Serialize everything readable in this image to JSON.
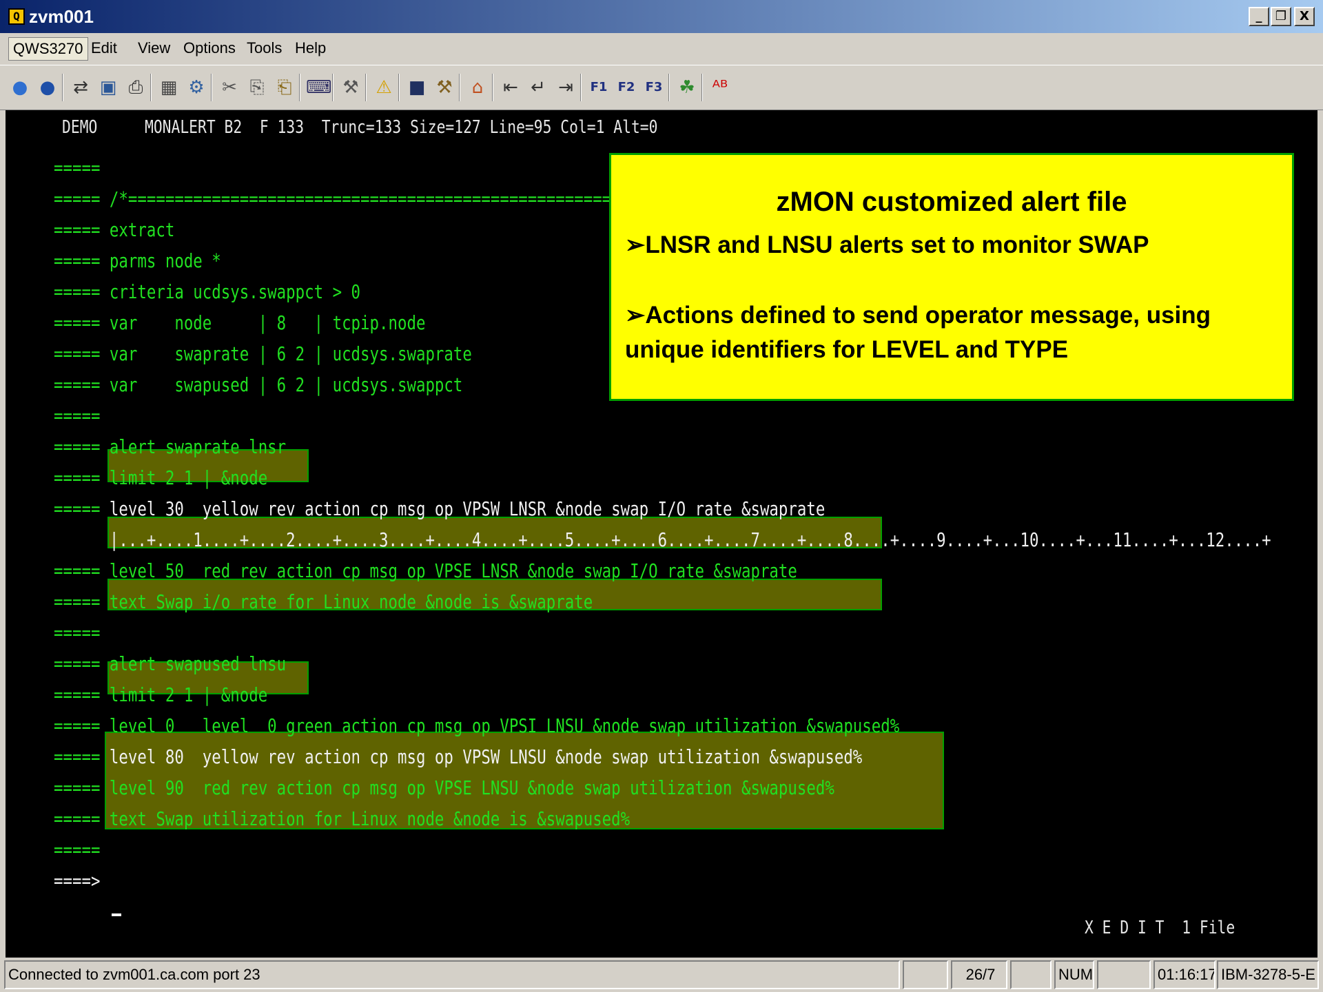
{
  "window": {
    "title": "zvm001",
    "minimize": "_",
    "maximize": "❐",
    "close": "X"
  },
  "menu": [
    "QWS3270",
    "Edit",
    "View",
    "Options",
    "Tools",
    "Help"
  ],
  "toolbar": [
    {
      "name": "connect-globe-icon",
      "glyph": "●",
      "color": "#2f6fd0"
    },
    {
      "name": "disconnect-globe-icon",
      "glyph": "●",
      "color": "#1e4fa8"
    },
    {
      "name": "transfer-icon",
      "glyph": "⇄",
      "color": "#333333"
    },
    {
      "name": "screen-icon",
      "glyph": "▣",
      "color": "#2b5797"
    },
    {
      "name": "print-icon",
      "glyph": "⎙",
      "color": "#333333"
    },
    {
      "name": "capture-icon",
      "glyph": "▦",
      "color": "#444444"
    },
    {
      "name": "macro-icon",
      "glyph": "⚙",
      "color": "#3060a0"
    },
    {
      "name": "cut-icon",
      "glyph": "✂",
      "color": "#555555"
    },
    {
      "name": "copy-icon",
      "glyph": "⎘",
      "color": "#555555"
    },
    {
      "name": "paste-icon",
      "glyph": "⎗",
      "color": "#8a6a1a"
    },
    {
      "name": "keyboard-icon",
      "glyph": "⌨",
      "color": "#333366"
    },
    {
      "name": "tools-icon",
      "glyph": "⚒",
      "color": "#555555"
    },
    {
      "name": "warning-icon",
      "glyph": "⚠",
      "color": "#d4a000"
    },
    {
      "name": "terminal-icon",
      "glyph": "■",
      "color": "#203060"
    },
    {
      "name": "settings-icon",
      "glyph": "⚒",
      "color": "#806020"
    },
    {
      "name": "home-icon",
      "glyph": "⌂",
      "color": "#c05020"
    },
    {
      "name": "field-back-icon",
      "glyph": "⇤",
      "color": "#333333"
    },
    {
      "name": "newline-icon",
      "glyph": "↵",
      "color": "#333333"
    },
    {
      "name": "field-forward-icon",
      "glyph": "⇥",
      "color": "#333333"
    },
    {
      "name": "pf1-icon",
      "glyph": "F1",
      "color": "#203080"
    },
    {
      "name": "pf2-icon",
      "glyph": "F2",
      "color": "#203080"
    },
    {
      "name": "pf3-icon",
      "glyph": "F3",
      "color": "#203080"
    },
    {
      "name": "leaf-icon",
      "glyph": "☘",
      "color": "#2e8b2e"
    },
    {
      "name": "spellcheck-icon",
      "glyph": "ᴬᴮ",
      "color": "#cc0000"
    }
  ],
  "terminal": {
    "header": {
      "demo": "DEMO",
      "info": "MONALERT B2  F 133  Trunc=133 Size=127 Line=95 Col=1 Alt=0"
    },
    "lines": [
      {
        "prefix": "=====",
        "text": "",
        "color": "#21e021"
      },
      {
        "prefix": "=====",
        "text": "/*====================================================",
        "color": "#21e021"
      },
      {
        "prefix": "=====",
        "text": "extract",
        "color": "#21e021"
      },
      {
        "prefix": "=====",
        "text": "parms node *",
        "color": "#21e021"
      },
      {
        "prefix": "=====",
        "text": "criteria ucdsys.swappct > 0",
        "color": "#21e021"
      },
      {
        "prefix": "=====",
        "text": "var    node     | 8   | tcpip.node",
        "color": "#21e021"
      },
      {
        "prefix": "=====",
        "text": "var    swaprate | 6 2 | ucdsys.swaprate",
        "color": "#21e021"
      },
      {
        "prefix": "=====",
        "text": "var    swapused | 6 2 | ucdsys.swappct",
        "color": "#21e021"
      },
      {
        "prefix": "=====",
        "text": "",
        "color": "#21e021"
      },
      {
        "prefix": "=====",
        "text": "alert swaprate lnsr",
        "color": "#21e021"
      },
      {
        "prefix": "=====",
        "text": "limit 2 1 | &node",
        "color": "#21e021"
      },
      {
        "prefix": "=====",
        "text": "level 30  yellow rev action cp msg op VPSW LNSR &node swap I/O rate &swaprate",
        "color": "#f0f0f0"
      },
      {
        "prefix": "",
        "text": "|...+....1....+....2....+....3....+....4....+....5....+....6....+....7....+....8....+....9....+...10....+...11....+...12....+",
        "color": "#f0f0f0"
      },
      {
        "prefix": "=====",
        "text": "level 50  red rev action cp msg op VPSE LNSR &node swap I/O rate &swaprate",
        "color": "#21e021"
      },
      {
        "prefix": "=====",
        "text": "text Swap i/o rate for Linux node &node is &swaprate",
        "color": "#21e021"
      },
      {
        "prefix": "=====",
        "text": "",
        "color": "#21e021"
      },
      {
        "prefix": "=====",
        "text": "alert swapused lnsu",
        "color": "#21e021"
      },
      {
        "prefix": "=====",
        "text": "limit 2 1 | &node",
        "color": "#21e021"
      },
      {
        "prefix": "=====",
        "text": "level 0   level  0 green action cp msg op VPSI LNSU &node swap utilization &swapused%",
        "color": "#21e021"
      },
      {
        "prefix": "=====",
        "text": "level 80  yellow rev action cp msg op VPSW LNSU &node swap utilization &swapused%",
        "color": "#f0f0f0"
      },
      {
        "prefix": "=====",
        "text": "level 90  red rev action cp msg op VPSE LNSU &node swap utilization &swapused%",
        "color": "#21e021"
      },
      {
        "prefix": "=====",
        "text": "text Swap utilization for Linux node &node is &swapused%",
        "color": "#21e021"
      },
      {
        "prefix": "=====",
        "text": "",
        "color": "#21e021"
      },
      {
        "prefix": "====>",
        "text": "",
        "color": "#f0f0f0"
      }
    ],
    "mode": "X E D I T  1 File"
  },
  "callout": {
    "title": "zMON customized alert file",
    "bullet": "➢",
    "line1": "LNSR and LNSU alerts set to monitor SWAP",
    "line2": "Actions defined to send operator message, using",
    "line3": "unique identifiers for LEVEL and TYPE"
  },
  "statusbar": {
    "connection": "Connected to zvm001.ca.com port 23",
    "cursor_pos": "26/7",
    "num": "NUM",
    "time": "01:16:17",
    "terminal_type": "IBM-3278-5-E"
  }
}
